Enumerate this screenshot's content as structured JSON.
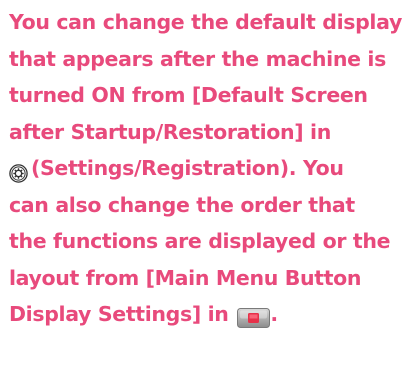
{
  "note": {
    "line1": "You can change the default display",
    "line2": "that appears after the machine is",
    "line3": "turned ON from [Default Screen",
    "line4": "after Startup/Restoration] in",
    "line5": "(Settings/Registration). You",
    "line6": "can also change the order that",
    "line7": "the functions are displayed or the",
    "line8": "layout from [Main Menu Button",
    "line9": "Display Settings] in",
    "line9_end": "."
  },
  "icons": {
    "settings": "settings-registration-icon",
    "main_menu": "main-menu-icon"
  },
  "colors": {
    "text": "#e84a7c"
  }
}
